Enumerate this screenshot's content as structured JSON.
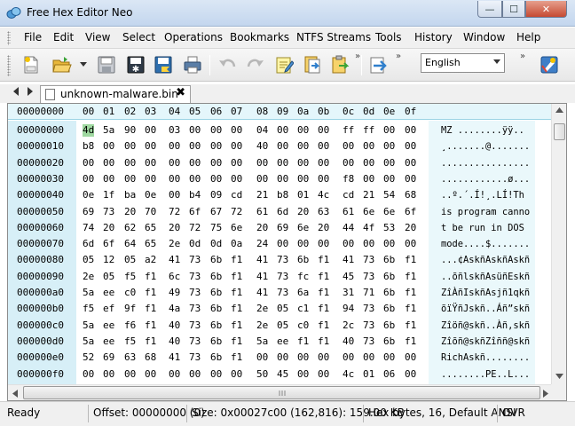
{
  "window": {
    "title": "Free Hex Editor Neo",
    "min_glyph": "—",
    "max_glyph": "☐",
    "close_glyph": "✕"
  },
  "menu": [
    "File",
    "Edit",
    "View",
    "Select",
    "Operations",
    "Bookmarks",
    "NTFS Streams",
    "Tools",
    "History",
    "Window",
    "Help"
  ],
  "toolbar": {
    "icons": [
      "new-file-icon",
      "open-folder-icon",
      "dropdown-arrow-icon",
      "save-icon",
      "save-all-icon",
      "save-as-icon",
      "print-icon",
      "undo-icon",
      "redo-icon",
      "edit-notepad-icon",
      "copy-to-clipboard-icon",
      "paste-icon",
      "export-icon",
      "settings-wizard-icon"
    ],
    "overflow_glyph": "»",
    "encoding": "English"
  },
  "tab": {
    "filename": "unknown-malware.bin",
    "close_glyph": "✖"
  },
  "hex_view": {
    "header_offset": "00000000",
    "column_headers": [
      "00",
      "01",
      "02",
      "03",
      "04",
      "05",
      "06",
      "07",
      "08",
      "09",
      "0a",
      "0b",
      "0c",
      "0d",
      "0e",
      "0f"
    ],
    "rows": [
      {
        "offset": "00000000",
        "bytes": [
          "4d",
          "5a",
          "90",
          "00",
          "03",
          "00",
          "00",
          "00",
          "04",
          "00",
          "00",
          "00",
          "ff",
          "ff",
          "00",
          "00"
        ],
        "ascii": "MZ ........ÿÿ.."
      },
      {
        "offset": "00000010",
        "bytes": [
          "b8",
          "00",
          "00",
          "00",
          "00",
          "00",
          "00",
          "00",
          "40",
          "00",
          "00",
          "00",
          "00",
          "00",
          "00",
          "00"
        ],
        "ascii": "¸.......@......."
      },
      {
        "offset": "00000020",
        "bytes": [
          "00",
          "00",
          "00",
          "00",
          "00",
          "00",
          "00",
          "00",
          "00",
          "00",
          "00",
          "00",
          "00",
          "00",
          "00",
          "00"
        ],
        "ascii": "................"
      },
      {
        "offset": "00000030",
        "bytes": [
          "00",
          "00",
          "00",
          "00",
          "00",
          "00",
          "00",
          "00",
          "00",
          "00",
          "00",
          "00",
          "f8",
          "00",
          "00",
          "00"
        ],
        "ascii": "............ø..."
      },
      {
        "offset": "00000040",
        "bytes": [
          "0e",
          "1f",
          "ba",
          "0e",
          "00",
          "b4",
          "09",
          "cd",
          "21",
          "b8",
          "01",
          "4c",
          "cd",
          "21",
          "54",
          "68"
        ],
        "ascii": "..º.´.Í!¸.LÍ!Th"
      },
      {
        "offset": "00000050",
        "bytes": [
          "69",
          "73",
          "20",
          "70",
          "72",
          "6f",
          "67",
          "72",
          "61",
          "6d",
          "20",
          "63",
          "61",
          "6e",
          "6e",
          "6f"
        ],
        "ascii": "is program canno"
      },
      {
        "offset": "00000060",
        "bytes": [
          "74",
          "20",
          "62",
          "65",
          "20",
          "72",
          "75",
          "6e",
          "20",
          "69",
          "6e",
          "20",
          "44",
          "4f",
          "53",
          "20"
        ],
        "ascii": "t be run in DOS "
      },
      {
        "offset": "00000070",
        "bytes": [
          "6d",
          "6f",
          "64",
          "65",
          "2e",
          "0d",
          "0d",
          "0a",
          "24",
          "00",
          "00",
          "00",
          "00",
          "00",
          "00",
          "00"
        ],
        "ascii": "mode....$......."
      },
      {
        "offset": "00000080",
        "bytes": [
          "05",
          "12",
          "05",
          "a2",
          "41",
          "73",
          "6b",
          "f1",
          "41",
          "73",
          "6b",
          "f1",
          "41",
          "73",
          "6b",
          "f1"
        ],
        "ascii": "...¢AskñAskñAskñ"
      },
      {
        "offset": "00000090",
        "bytes": [
          "2e",
          "05",
          "f5",
          "f1",
          "6c",
          "73",
          "6b",
          "f1",
          "41",
          "73",
          "fc",
          "f1",
          "45",
          "73",
          "6b",
          "f1"
        ],
        "ascii": "..õñlskñAsüñEskñ"
      },
      {
        "offset": "000000a0",
        "bytes": [
          "5a",
          "ee",
          "c0",
          "f1",
          "49",
          "73",
          "6b",
          "f1",
          "41",
          "73",
          "6a",
          "f1",
          "31",
          "71",
          "6b",
          "f1"
        ],
        "ascii": "ZîÀñIskñAsjñ1qkñ"
      },
      {
        "offset": "000000b0",
        "bytes": [
          "f5",
          "ef",
          "9f",
          "f1",
          "4a",
          "73",
          "6b",
          "f1",
          "2e",
          "05",
          "c1",
          "f1",
          "94",
          "73",
          "6b",
          "f1"
        ],
        "ascii": "õïŸñJskñ..Áñ”skñ"
      },
      {
        "offset": "000000c0",
        "bytes": [
          "5a",
          "ee",
          "f6",
          "f1",
          "40",
          "73",
          "6b",
          "f1",
          "2e",
          "05",
          "c0",
          "f1",
          "2c",
          "73",
          "6b",
          "f1"
        ],
        "ascii": "Zîöñ@skñ..Àñ,skñ"
      },
      {
        "offset": "000000d0",
        "bytes": [
          "5a",
          "ee",
          "f5",
          "f1",
          "40",
          "73",
          "6b",
          "f1",
          "5a",
          "ee",
          "f1",
          "f1",
          "40",
          "73",
          "6b",
          "f1"
        ],
        "ascii": "Zîõñ@skñZîññ@skñ"
      },
      {
        "offset": "000000e0",
        "bytes": [
          "52",
          "69",
          "63",
          "68",
          "41",
          "73",
          "6b",
          "f1",
          "00",
          "00",
          "00",
          "00",
          "00",
          "00",
          "00",
          "00"
        ],
        "ascii": "RichAskñ........"
      },
      {
        "offset": "000000f0",
        "bytes": [
          "00",
          "00",
          "00",
          "00",
          "00",
          "00",
          "00",
          "00",
          "50",
          "45",
          "00",
          "00",
          "4c",
          "01",
          "06",
          "00"
        ],
        "ascii": "........PE..L..."
      }
    ]
  },
  "status": {
    "state": "Ready",
    "offset": "Offset: 00000000 (0)",
    "size": "Size: 0x00027c00 (162,816): 159.00 KB",
    "mode": "Hex bytes, 16, Default ANSI",
    "insert": "OVR"
  },
  "colors": {
    "offset_bg": "#d7eff7",
    "header_bg": "#e4f6fb",
    "selection": "#9fd8a0",
    "title_bg": "#c3d6ee"
  }
}
